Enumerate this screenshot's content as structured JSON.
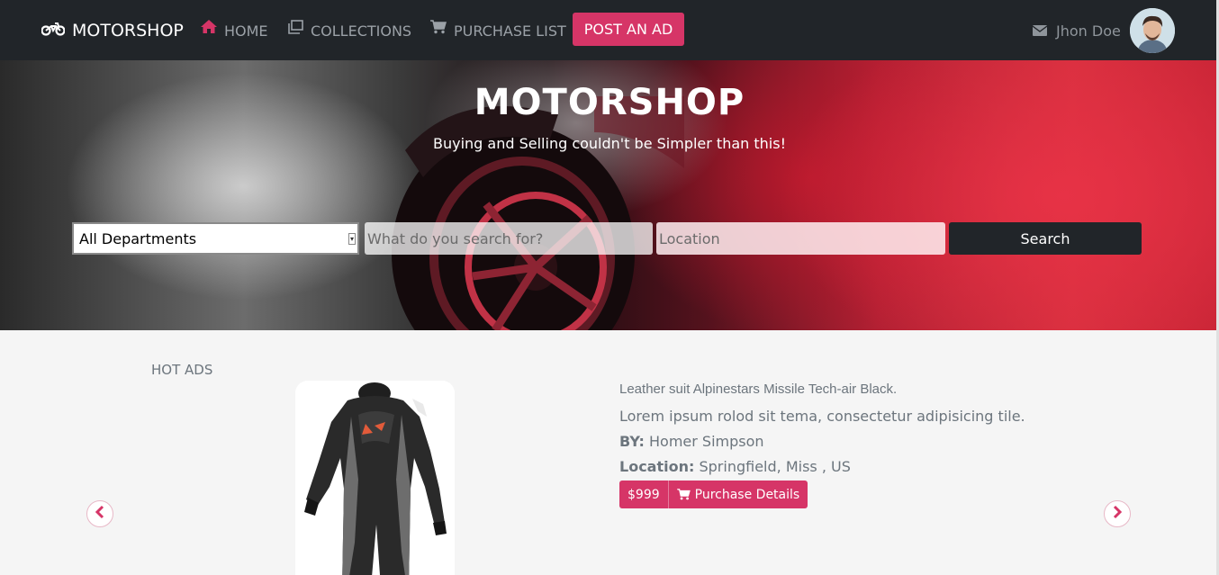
{
  "navbar": {
    "brand": "MOTORSHOP",
    "brand_icon": "motorcycle-icon",
    "links": [
      {
        "label": "HOME",
        "icon": "home-icon"
      },
      {
        "label": "COLLECTIONS",
        "icon": "collections-icon"
      },
      {
        "label": "PURCHASE LIST",
        "icon": "cart-icon"
      }
    ],
    "post_ad_label": "POST AN AD",
    "user_name": "Jhon Doe",
    "user_icon": "envelope-icon",
    "accent_color": "#d63567",
    "background_color": "#212529"
  },
  "hero": {
    "title": "MOTORSHOP",
    "subtitle": "Buying and Selling couldn't be Simpler than this!",
    "department_select": {
      "selected": "All Departments"
    },
    "search_placeholder": "What do you search for?",
    "location_placeholder": "Location",
    "search_button": "Search"
  },
  "hot_ads": {
    "label": "HOT ADS",
    "item": {
      "title": "Leather suit Alpinestars Missile Tech-air Black.",
      "description": "Lorem ipsum rolod sit tema, consectetur adipisicing tile.",
      "by_label": "BY:",
      "by_value": "Homer Simpson",
      "location_label": "Location:",
      "location_value": "Springfield, Miss , US",
      "price": "$999",
      "purchase_label": "Purchase Details",
      "purchase_icon": "cart-icon"
    },
    "prev_icon": "chevron-left-icon",
    "next_icon": "chevron-right-icon"
  }
}
